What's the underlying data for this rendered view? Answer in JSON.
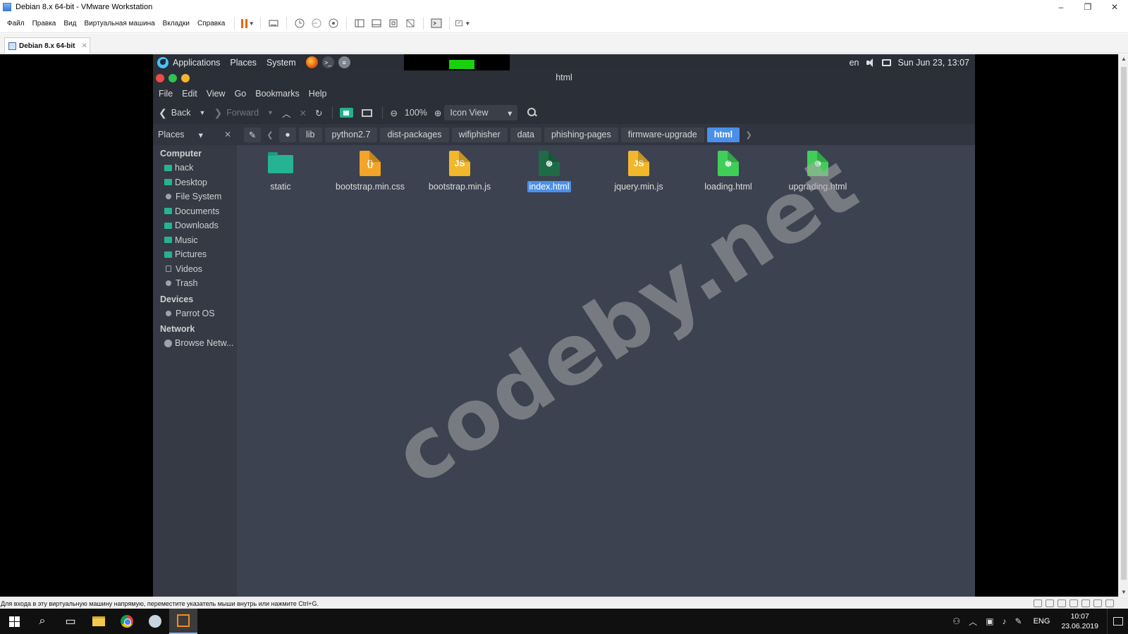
{
  "vmware": {
    "title": "Debian 8.x 64-bit - VMware Workstation",
    "menu": [
      "Файл",
      "Правка",
      "Вид",
      "Виртуальная машина",
      "Вкладки",
      "Справка"
    ],
    "tab_label": "Debian 8.x 64-bit",
    "status_text": "Для входа в эту виртуальную машину напрямую, переместите указатель мыши внутрь или нажмите Ctrl+G.",
    "window_controls": [
      "–",
      "❐",
      "✕"
    ]
  },
  "guest_panel": {
    "menus": [
      "Applications",
      "Places",
      "System"
    ],
    "keyboard_layout": "en",
    "clock": "Sun Jun 23, 13:07"
  },
  "file_manager": {
    "window_title": "html",
    "menu": [
      "File",
      "Edit",
      "View",
      "Go",
      "Bookmarks",
      "Help"
    ],
    "toolbar": {
      "back": "Back",
      "forward": "Forward",
      "zoom": "100%",
      "view_mode": "Icon View"
    },
    "places_label": "Places",
    "breadcrumbs": [
      "lib",
      "python2.7",
      "dist-packages",
      "wifiphisher",
      "data",
      "phishing-pages",
      "firmware-upgrade",
      "html"
    ],
    "active_crumb": "html",
    "sidebar": {
      "computer_heading": "Computer",
      "computer_items": [
        "hack",
        "Desktop",
        "File System",
        "Documents",
        "Downloads",
        "Music",
        "Pictures",
        "Videos",
        "Trash"
      ],
      "devices_heading": "Devices",
      "devices_items": [
        "Parrot OS"
      ],
      "network_heading": "Network",
      "network_items": [
        "Browse Netw..."
      ]
    },
    "files": [
      {
        "name": "static",
        "type": "folder"
      },
      {
        "name": "bootstrap.min.css",
        "type": "css"
      },
      {
        "name": "bootstrap.min.js",
        "type": "js"
      },
      {
        "name": "index.html",
        "type": "html",
        "selected": true
      },
      {
        "name": "jquery.min.js",
        "type": "js"
      },
      {
        "name": "loading.html",
        "type": "html"
      },
      {
        "name": "upgrading.html",
        "type": "html"
      }
    ]
  },
  "watermark": "codeby.net",
  "taskbar": {
    "language": "ENG",
    "time": "10:07",
    "date": "23.06.2019"
  },
  "colors": {
    "guest_bg": "#3c4250",
    "accent_blue": "#4c8fe8",
    "folder_teal": "#26b394"
  }
}
